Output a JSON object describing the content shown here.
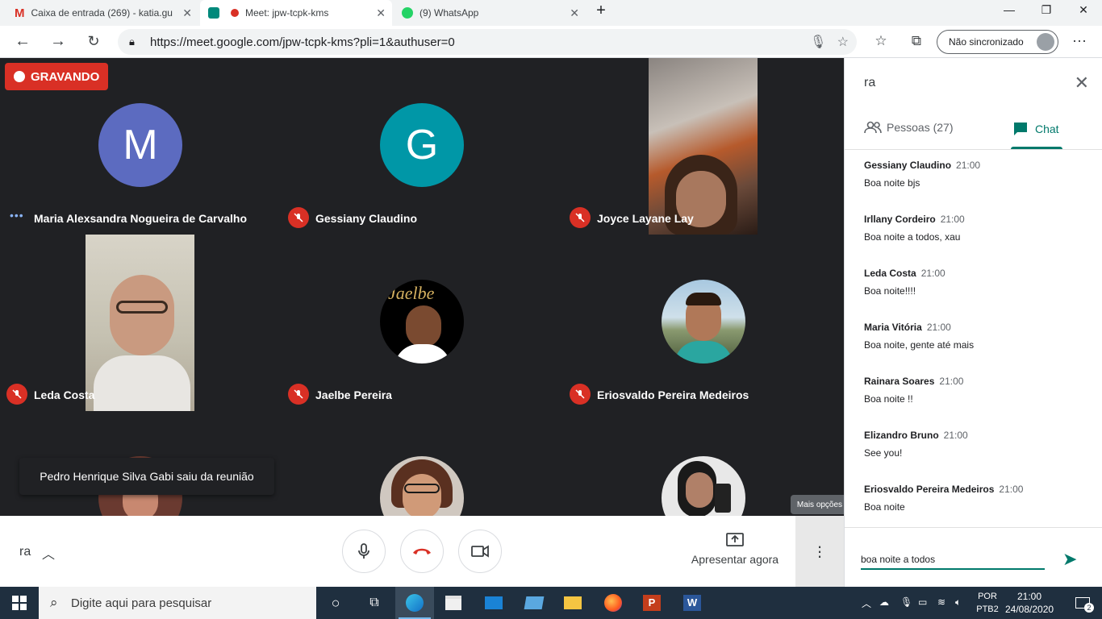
{
  "browser": {
    "tabs": [
      {
        "title": "Caixa de entrada (269) - katia.gu",
        "icon": "gmail-icon"
      },
      {
        "title": "Meet: jpw-tcpk-kms",
        "icon": "meet-icon"
      },
      {
        "title": "(9) WhatsApp",
        "icon": "whatsapp-icon"
      }
    ],
    "url": "https://meet.google.com/jpw-tcpk-kms?pli=1&authuser=0",
    "sync_label": "Não sincronizado"
  },
  "meet": {
    "recording_label": "GRAVANDO",
    "participants": [
      {
        "name": "Maria Alexsandra Nogueira de Carvalho",
        "initial": "M",
        "avatar_color": "#5c6bc0",
        "muted": false
      },
      {
        "name": "Gessiany Claudino",
        "initial": "G",
        "avatar_color": "#0097a7",
        "muted": true
      },
      {
        "name": "Joyce Layane Lay",
        "muted": true
      },
      {
        "name": "Leda Costa",
        "muted": true
      },
      {
        "name": "Jaelbe Pereira",
        "avatar_text": "Jaelbe",
        "muted": true
      },
      {
        "name": "Eriosvaldo Pereira Medeiros",
        "muted": true
      }
    ],
    "toast": "Pedro Henrique Silva Gabi saiu da reunião",
    "tooltip": "Mais opções",
    "meeting_code": "ra",
    "present_label": "Apresentar agora"
  },
  "panel": {
    "title": "ra",
    "tabs": {
      "people": "Pessoas (27)",
      "chat": "Chat"
    },
    "messages": [
      {
        "sender": "Gessiany Claudino",
        "time": "21:00",
        "text": "Boa noite bjs"
      },
      {
        "sender": "Irllany Cordeiro",
        "time": "21:00",
        "text": "Boa noite a todos, xau"
      },
      {
        "sender": "Leda Costa",
        "time": "21:00",
        "text": "Boa noite!!!!"
      },
      {
        "sender": "Maria Vitória",
        "time": "21:00",
        "text": "Boa noite, gente até mais"
      },
      {
        "sender": "Rainara Soares",
        "time": "21:00",
        "text": "Boa noite !!"
      },
      {
        "sender": "Elizandro Bruno",
        "time": "21:00",
        "text": "See you!"
      },
      {
        "sender": "Eriosvaldo Pereira Medeiros",
        "time": "21:00",
        "text": "Boa noite"
      }
    ],
    "compose_value": "boa noite a todos"
  },
  "taskbar": {
    "search_placeholder": "Digite aqui para pesquisar",
    "lang_line1": "POR",
    "lang_line2": "PTB2",
    "time": "21:00",
    "date": "24/08/2020",
    "notifications": "2"
  },
  "colors": {
    "recording": "#d93025",
    "accent": "#00796b",
    "meet_bg": "#202124"
  }
}
